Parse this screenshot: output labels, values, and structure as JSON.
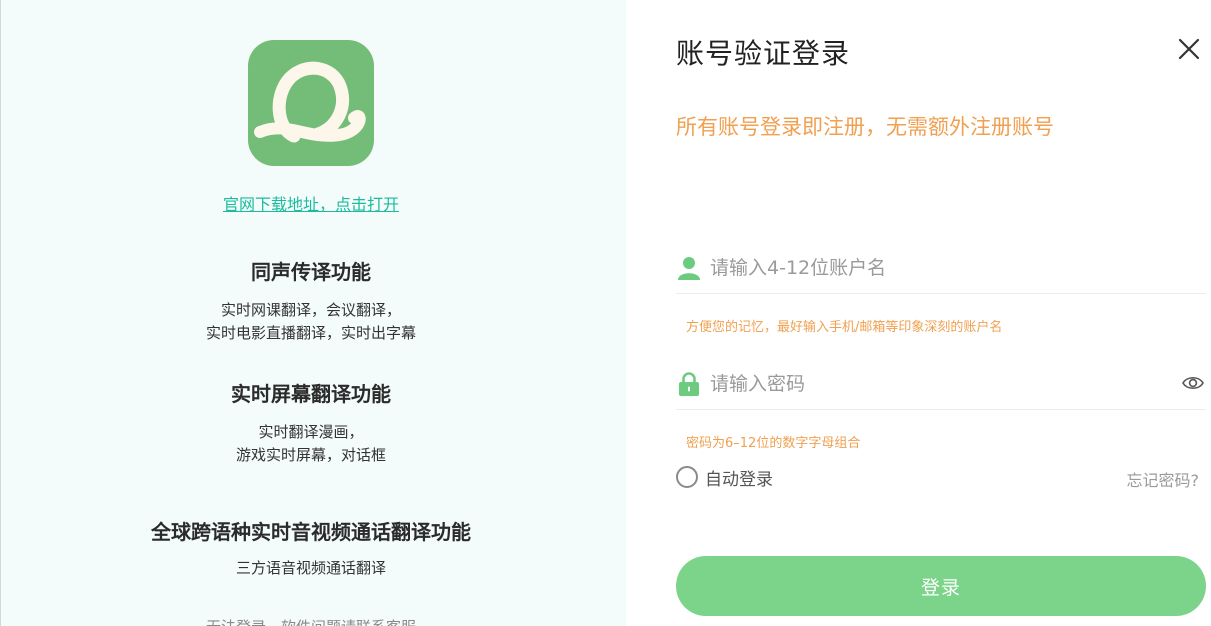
{
  "colors": {
    "brand_green": "#74bd78",
    "button_green": "#7cd48b",
    "hint_orange": "#f0a050",
    "link_teal": "#1abc9c",
    "panel_bg": "#f4fbfb"
  },
  "left": {
    "logo_icon": "app-logo-icon",
    "download_link": "官网下载地址，点击打开",
    "features": [
      {
        "title": "同声传译功能",
        "desc_lines": [
          "实时网课翻译，会议翻译，",
          "实时电影直播翻译，实时出字幕"
        ]
      },
      {
        "title": "实时屏幕翻译功能",
        "desc_lines": [
          "实时翻译漫画，",
          "游戏实时屏幕，对话框"
        ]
      },
      {
        "title": "全球跨语种实时音视频通话翻译功能",
        "desc_lines": [
          "三方语音视频通话翻译"
        ]
      }
    ],
    "help_text": "无法登录，软件问题请联系客服"
  },
  "login": {
    "title": "账号验证登录",
    "close_icon": "close-icon",
    "register_hint": "所有账号登录即注册，无需额外注册账号",
    "username": {
      "icon": "user-icon",
      "placeholder": "请输入4-12位账户名",
      "value": "",
      "hint": "方便您的记忆，最好输入手机/邮箱等印象深刻的账户名"
    },
    "password": {
      "icon": "lock-icon",
      "toggle_icon": "eye-icon",
      "placeholder": "请输入密码",
      "value": "",
      "hint": "密码为6–12位的数字字母组合"
    },
    "auto_login_label": "自动登录",
    "auto_login_checked": false,
    "forgot_label": "忘记密码?",
    "submit_label": "登录"
  }
}
